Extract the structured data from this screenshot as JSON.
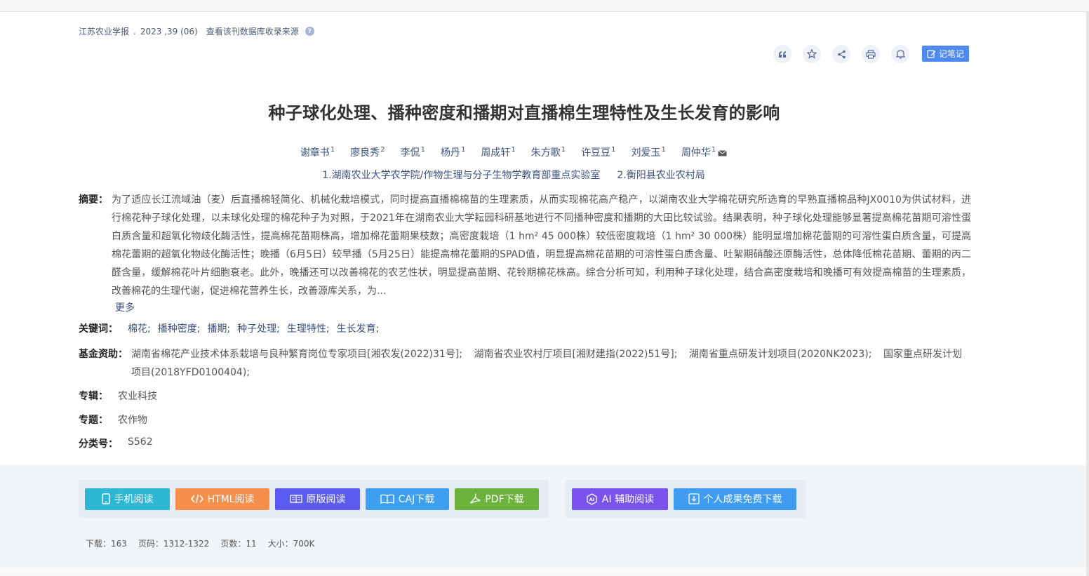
{
  "source": {
    "journal": "江苏农业学报",
    "year_issue": "2023 ,39 (06)",
    "db_link": "查看该刊数据库收录来源"
  },
  "toolbar": {
    "note_label": "记笔记"
  },
  "title": "种子球化处理、播种密度和播期对直播棉生理特性及生长发育的影响",
  "authors": [
    {
      "name": "谢章书",
      "sup": "1"
    },
    {
      "name": "廖良秀",
      "sup": "2"
    },
    {
      "name": "李侃",
      "sup": "1"
    },
    {
      "name": "杨丹",
      "sup": "1"
    },
    {
      "name": "周成轩",
      "sup": "1"
    },
    {
      "name": "朱方歌",
      "sup": "1"
    },
    {
      "name": "许豆豆",
      "sup": "1"
    },
    {
      "name": "刘爱玉",
      "sup": "1"
    },
    {
      "name": "周仲华",
      "sup": "1"
    }
  ],
  "orgs": [
    "1.湖南农业大学农学院/作物生理与分子生物学教育部重点实验室",
    "2.衡阳县农业农村局"
  ],
  "abstract": {
    "label": "摘要：",
    "text": "为了适应长江流域油（麦）后直播棉轻简化、机械化栽培模式，同时提高直播棉棉苗的生理素质，从而实现棉花高产稳产，以湖南农业大学棉花研究所选育的早熟直播棉品种JX0010为供试材料，进行棉花种子球化处理，以未球化处理的棉花种子为对照，于2021年在湖南农业大学耘园科研基地进行不同播种密度和播期的大田比较试验。结果表明，种子球化处理能够显著提高棉花苗期可溶性蛋白质含量和超氧化物歧化酶活性，提高棉花苗期株高，增加棉花蕾期果枝数；高密度栽培（1 hm² 45 000株）较低密度栽培（1 hm² 30 000株）能明显增加棉花蕾期的可溶性蛋白质含量，可提高棉花蕾期的超氧化物歧化酶活性；晚播（6月5日）较早播（5月25日）能提高棉花蕾期的SPAD值，明显提高棉花苗期的可溶性蛋白质含量、吐絮期硝酸还原酶活性，总体降低棉花苗期、蕾期的丙二醛含量，缓解棉花叶片细胞衰老。此外，晚播还可以改善棉花的农艺性状，明显提高苗期、花铃期棉花株高。综合分析可知，利用种子球化处理，结合高密度栽培和晚播可有效提高棉苗的生理素质，改善棉花的生理代谢，促进棉花营养生长，改善源库关系，为...",
    "more": "更多"
  },
  "keywords": {
    "label": "关键词：",
    "items": [
      "棉花;",
      "播种密度;",
      "播期;",
      "种子处理;",
      "生理特性;",
      "生长发育;"
    ]
  },
  "funding": {
    "label": "基金资助：",
    "items": [
      "湖南省棉花产业技术体系栽培与良种繁育岗位专家项目[湘农发(2022)31号];",
      "湖南省农业农村厅项目[湘财建指(2022)51号];",
      "湖南省重点研发计划项目(2020NK2023);",
      "国家重点研发计划项目(2018YFD0100404);"
    ]
  },
  "zhuanji": {
    "label": "专辑：",
    "value": "农业科技"
  },
  "zhuanti": {
    "label": "专题：",
    "value": "农作物"
  },
  "classno": {
    "label": "分类号：",
    "value": "S562"
  },
  "buttons": {
    "mobile": "手机阅读",
    "html": "HTML阅读",
    "original": "原版阅读",
    "caj": "CAJ下载",
    "pdf": "PDF下载",
    "ai": "AI 辅助阅读",
    "personal": "个人成果免费下载"
  },
  "colors": {
    "mobile": "#2db7d4",
    "html": "#f58f4b",
    "original": "#5b5cef",
    "caj": "#3c9ff0",
    "pdf": "#6cb33e",
    "ai": "#7a52ef",
    "personal": "#3f9cf0"
  },
  "stats": {
    "downloads": "下载：163",
    "pages": "页码：1312-1322",
    "page_count": "页数：11",
    "size": "大小：700K"
  }
}
